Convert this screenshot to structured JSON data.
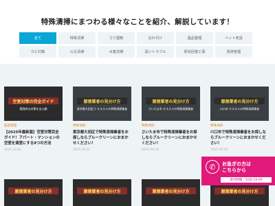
{
  "hero": {
    "title": "特殊清掃にまつわる様々なことを紹介、解説しています！"
  },
  "tabs": [
    "全て",
    "特殊清掃",
    "ゴミ屋敷",
    "お片付け",
    "遺品整理",
    "ペット死臭",
    "カビ対策",
    "火災清掃",
    "水害清掃",
    "臭いトラブル",
    "原状回復工事",
    "賃貸管理"
  ],
  "cards": [
    {
      "thumb_banner": "空室対策の完全ガイド",
      "thumb_sub": "実践的な対策を全公開",
      "category": "賃貸管理",
      "title": "【2025年最新版】空室対策完全ガイド！アパート・マンションの空室を満室にする9つの方法",
      "date": "2025.10.02"
    },
    {
      "thumb_banner": "悪徳業者の見分け方",
      "thumb_sub": "東京都大田区で オススメの特殊清掃業者",
      "category": "特殊清掃",
      "title": "東京都大田区で特殊清掃業者をお探しならブルークリーンにおまかせください！",
      "date": "2025.09.21"
    },
    {
      "thumb_banner": "悪徳業者の見分け方",
      "thumb_sub": "さいたま市 オススメの特殊清掃業者",
      "category": "特殊清掃",
      "title": "さいたま市で特殊清掃業者をお探しならブルークリーンにおまかせください！",
      "date": "2025.09.20"
    },
    {
      "thumb_banner": "悪徳業者の見分け方",
      "thumb_sub": "川口市 オススメの特殊清掃業者",
      "category": "特殊清掃",
      "title": "川口市で特殊清掃業者をお探しならブルークリーンにおまかせください！",
      "date": "2025.09.19"
    }
  ],
  "row2_banners": [
    "悪徳業者の見分け方",
    "悪徳業者の見分け方",
    "悪徳業者の見分け方",
    "悪徳業者の見分け方"
  ],
  "consult": {
    "line1": "お急ぎの方は",
    "line2": "こちらから",
    "hours": "受付時間｜9:00-19:00",
    "icon": "phone-icon"
  },
  "colors": {
    "accent": "#0aa6d6",
    "category": "#e08a1e",
    "consult": "#e0197a",
    "bg": "#eef3f6"
  }
}
